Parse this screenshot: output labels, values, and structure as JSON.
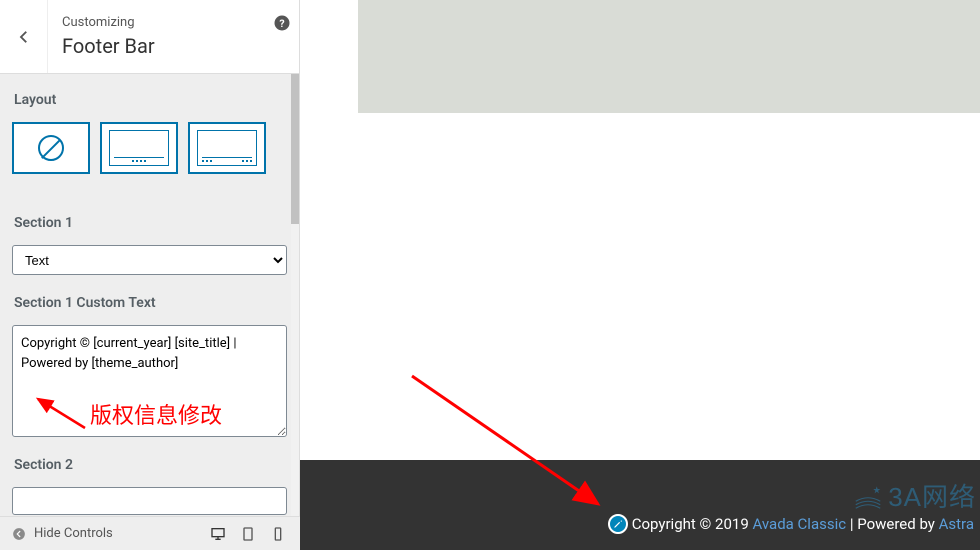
{
  "panel": {
    "crumb": "Customizing",
    "title": "Footer Bar"
  },
  "labels": {
    "layout": "Layout",
    "section1": "Section 1",
    "section1_custom_text": "Section 1 Custom Text",
    "section2": "Section 2"
  },
  "section1_select": {
    "value": "Text",
    "options": [
      "Text"
    ]
  },
  "section1_textarea": "Copyright © [current_year] [site_title] | Powered by [theme_author]",
  "footer_controls": {
    "hide_label": "Hide Controls"
  },
  "preview": {
    "copyright_prefix": "Copyright © 2019 ",
    "site_title": "Avada Classic",
    "separator": " | Powered by ",
    "theme_author": "Astra"
  },
  "annotation1": "版权信息修改",
  "watermark": "3A网络",
  "layout_selected": 0
}
